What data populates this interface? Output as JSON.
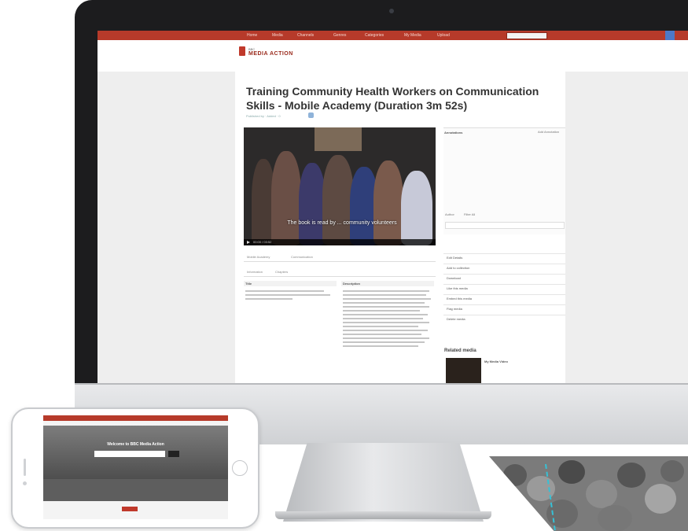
{
  "site": {
    "nav_items": [
      "Home",
      "Media",
      "Channels",
      "Genres",
      "Categories",
      "My Media",
      "Upload"
    ],
    "logo_name": "MEDIA ACTION",
    "logo_small": "BBC"
  },
  "page": {
    "title": "Training Community Health Workers on Communication Skills - Mobile Academy (Duration 3m 52s)",
    "meta": "Published by  ·  Added  ·  0"
  },
  "video": {
    "caption": "The book is read by ... community volunteers",
    "time": "00:00 / 03:52"
  },
  "tabs_row": {
    "tags": "Mobile Academy",
    "cat": "Communication"
  },
  "subtabs": {
    "info": "Information",
    "share": "Chapters"
  },
  "details": {
    "title_label": "Title",
    "description_label": "Description"
  },
  "sidebar": {
    "annotations_title": "Annotations",
    "annotations_button": "Add Annotation",
    "annot_chip1": "Author",
    "annot_chip2": "Filter All",
    "links": [
      "Edit Details",
      "Add to collection",
      "Download",
      "Like this media",
      "Embed this media",
      "Flag media",
      "Delete media"
    ],
    "related_title": "Related media",
    "related_item": "My Media Video"
  },
  "phone": {
    "welcome": "Welcome to BBC Media Action"
  },
  "colors": {
    "brand_red": "#b63a2a",
    "accent_cyan": "#36c1d6",
    "bezel": "#1c1c1e"
  }
}
